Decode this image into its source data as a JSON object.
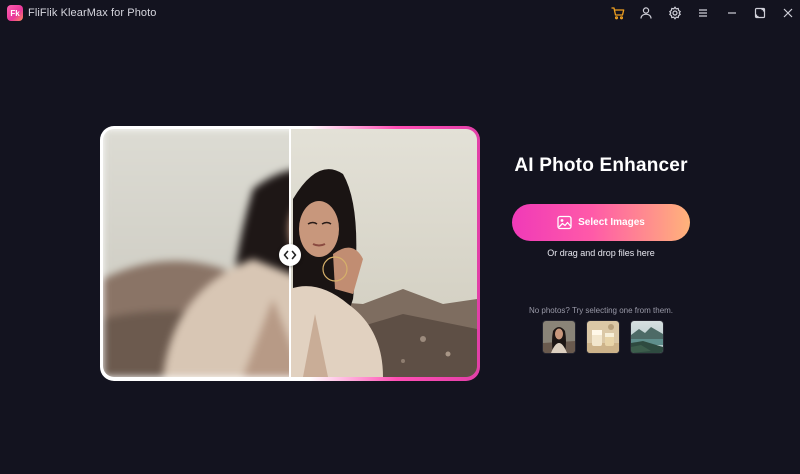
{
  "window": {
    "app_logo_text": "Fk",
    "app_title": "FliFlik KlearMax for Photo"
  },
  "titlebar": {
    "icons": [
      "cart-icon",
      "user-icon",
      "gear-icon",
      "menu-icon",
      "minimize-icon",
      "maximize-icon",
      "close-icon"
    ],
    "cart_color": "#f0a020"
  },
  "main": {
    "headline": "AI Photo Enhancer",
    "select_button_label": "Select Images",
    "drag_hint": "Or drag and drop files here",
    "samples_hint": "No photos? Try selecting one from them.",
    "sample_thumbs": [
      "portrait-sample",
      "drinks-sample",
      "landscape-sample"
    ]
  },
  "colors": {
    "background": "#13131f",
    "accent_pink": "#f03ab8",
    "accent_orange": "#ffb37a"
  }
}
